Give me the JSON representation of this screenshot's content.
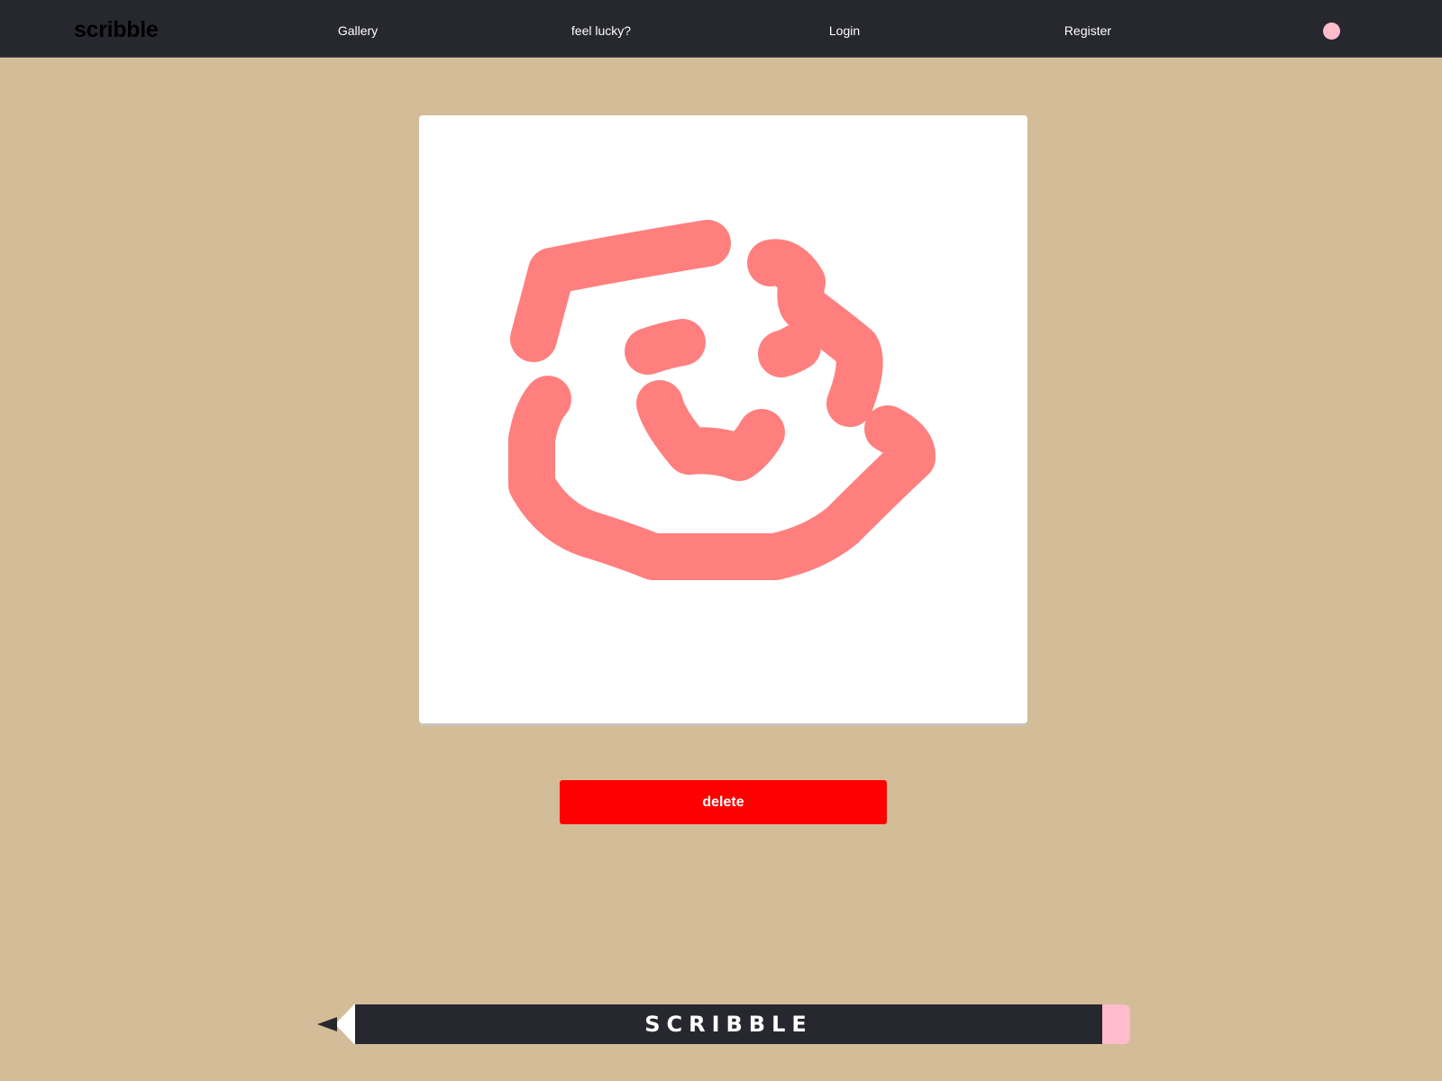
{
  "navbar": {
    "brand": "scribble",
    "links": [
      {
        "label": "Gallery"
      },
      {
        "label": "feel lucky?"
      },
      {
        "label": "Login"
      },
      {
        "label": "Register"
      }
    ],
    "color_dot": {
      "icon": "color-dot-icon",
      "color": "#ffbccb"
    }
  },
  "canvas": {
    "background": "#ffffff",
    "stroke_color": "#ff7f7f"
  },
  "actions": {
    "delete_label": "delete",
    "delete_color": "#ff0000"
  },
  "footer": {
    "logo_text": "SCRIBBLE",
    "icon": "pencil-icon",
    "body_color": "#272730",
    "eraser_color": "#ffbccb"
  },
  "theme": {
    "page_background": "#d3bc98",
    "nav_background": "#272730"
  }
}
